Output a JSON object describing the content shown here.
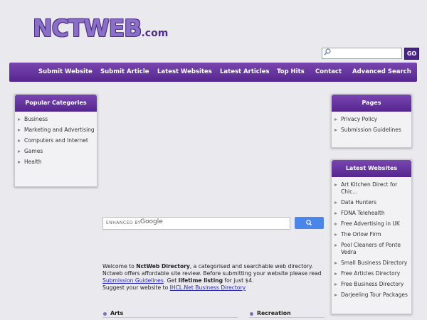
{
  "logo": {
    "main": "NCTWEB",
    "suffix": ".com"
  },
  "search": {
    "placeholder": "",
    "go_label": "GO"
  },
  "nav": [
    "Submit Website",
    "Submit Article",
    "Latest Websites",
    "Latest Articles",
    "Top Hits",
    "Contact",
    "Advanced Search"
  ],
  "popular": {
    "title": "Popular Categories",
    "items": [
      "Business",
      "Marketing and Advertising",
      "Computers and Internet",
      "Games",
      "Health"
    ]
  },
  "pages": {
    "title": "Pages",
    "items": [
      "Privacy Policy",
      "Submission Guidelines"
    ]
  },
  "latest": {
    "title": "Latest Websites",
    "items": [
      "Art Kitchen Direct for Chic...",
      "Data Hunters",
      "FDNA Telehealth",
      "Free Advertising in UK",
      "The Orlow Firm",
      "Pool Cleaners of Ponte Vedra",
      "Small Business Directory",
      "Free Articles Directory",
      "Free Business Directory",
      "Darjeeling Tour Packages"
    ]
  },
  "google_search": {
    "enhanced": "ENHANCED BY",
    "brand": "Google"
  },
  "welcome": {
    "p1": "Welcome to ",
    "site": "NctWeb Directory",
    "p2": ", a categorised and searchable web directory.",
    "p3": "Nctweb offers affordable site review. Before submitting your website please read ",
    "link1": "Submission Guidelines",
    "p4": ". Get ",
    "lifetime": "lifetime listing",
    "p5": " for just $4.",
    "p6": "Suggest your website to ",
    "link2": "IHCL.Net Business Directory"
  },
  "categories": [
    "Arts",
    "Recreation"
  ]
}
